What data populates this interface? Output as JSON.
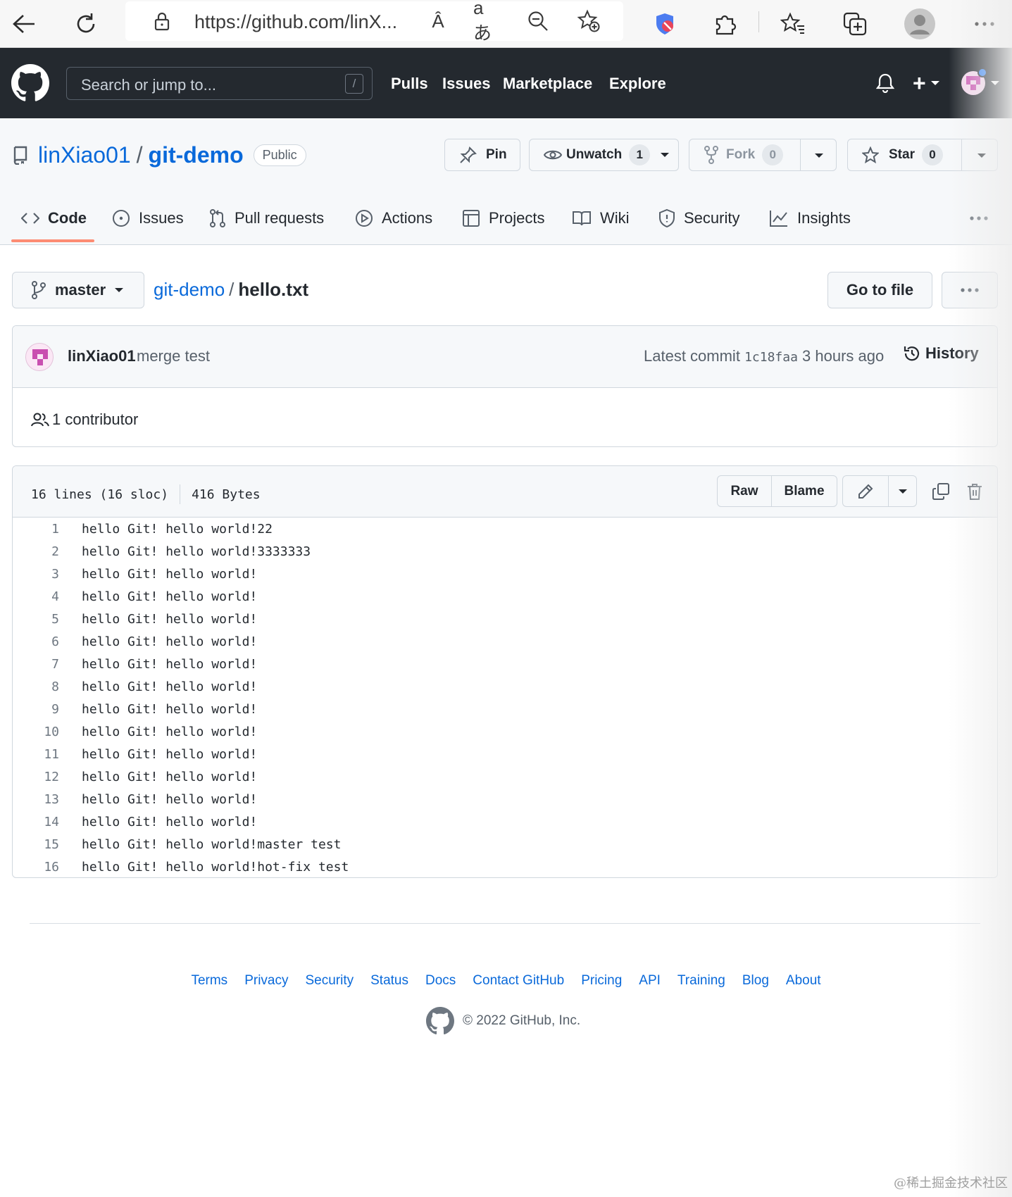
{
  "browser": {
    "url": "https://github.com/linX...",
    "read_aloud_glyph": "Â",
    "translate_glyph": "aあ"
  },
  "gh_header": {
    "search_placeholder": "Search or jump to...",
    "search_shortcut": "/",
    "nav": [
      "Pulls",
      "Issues",
      "Marketplace",
      "Explore"
    ],
    "plus_label": "+"
  },
  "repo": {
    "owner": "linXiao01",
    "separator": "/",
    "name": "git-demo",
    "visibility": "Public",
    "pin_label": "Pin",
    "unwatch_label": "Unwatch",
    "unwatch_count": "1",
    "fork_label": "Fork",
    "fork_count": "0",
    "star_label": "Star",
    "star_count": "0"
  },
  "tabs": [
    {
      "label": "Code",
      "icon": "code-icon",
      "active": true
    },
    {
      "label": "Issues",
      "icon": "issue-icon"
    },
    {
      "label": "Pull requests",
      "icon": "pull-request-icon"
    },
    {
      "label": "Actions",
      "icon": "play-icon"
    },
    {
      "label": "Projects",
      "icon": "table-icon"
    },
    {
      "label": "Wiki",
      "icon": "book-icon"
    },
    {
      "label": "Security",
      "icon": "shield-icon"
    },
    {
      "label": "Insights",
      "icon": "graph-icon"
    }
  ],
  "file_nav": {
    "branch": "master",
    "crumb_repo": "git-demo",
    "crumb_sep": "/",
    "crumb_file": "hello.txt",
    "goto_label": "Go to file"
  },
  "commit": {
    "author": "linXiao01",
    "message": "merge test",
    "latest_label": "Latest commit",
    "sha": "1c18faa",
    "time": "3 hours ago",
    "history_label": "History",
    "contributors": "1 contributor"
  },
  "file": {
    "lines_info": "16 lines (16 sloc)",
    "size": "416 Bytes",
    "raw_label": "Raw",
    "blame_label": "Blame",
    "lines": [
      "hello Git! hello world!22",
      "hello Git! hello world!3333333",
      "hello Git! hello world!",
      "hello Git! hello world!",
      "hello Git! hello world!",
      "hello Git! hello world!",
      "hello Git! hello world!",
      "hello Git! hello world!",
      "hello Git! hello world!",
      "hello Git! hello world!",
      "hello Git! hello world!",
      "hello Git! hello world!",
      "hello Git! hello world!",
      "hello Git! hello world!",
      "hello Git! hello world!master test",
      "hello Git! hello world!hot-fix test"
    ]
  },
  "footer": {
    "links": [
      "Terms",
      "Privacy",
      "Security",
      "Status",
      "Docs",
      "Contact GitHub",
      "Pricing",
      "API",
      "Training",
      "Blog",
      "About"
    ],
    "copyright": "© 2022 GitHub, Inc."
  },
  "watermark": "@稀土掘金技术社区",
  "colors": {
    "link": "#0969da",
    "header_bg": "#24292f",
    "tab_underline": "#fd8c73"
  }
}
